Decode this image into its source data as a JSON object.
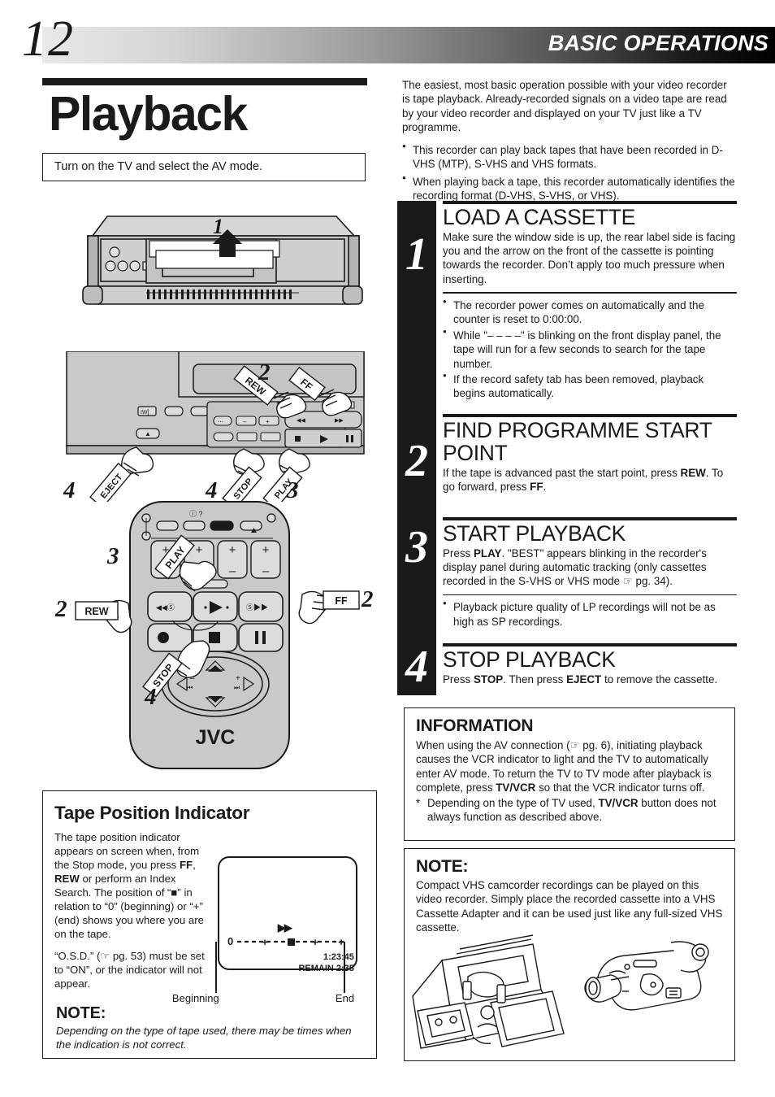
{
  "header": {
    "page_number": "12",
    "section_title": "BASIC OPERATIONS"
  },
  "left": {
    "title": "Playback",
    "intro_box": "Turn on the TV and select the AV mode.",
    "figures": {
      "vcr_top": {
        "name": "vcr-front-loading-cassette",
        "callouts": [
          {
            "label": "1"
          }
        ]
      },
      "vcr_front": {
        "name": "vcr-front-panel-controls",
        "callouts": [
          {
            "num": "2",
            "tag": "REW"
          },
          {
            "num": "2",
            "tag": "FF"
          },
          {
            "num": "4",
            "tag": "EJECT"
          },
          {
            "num": "4",
            "tag": "STOP"
          },
          {
            "num": "3",
            "tag": "PLAY"
          }
        ]
      },
      "remote": {
        "name": "jvc-remote-control",
        "brand": "JVC",
        "callouts": [
          {
            "num": "3",
            "tag": "PLAY"
          },
          {
            "num": "2",
            "tag": "REW"
          },
          {
            "num": "2",
            "tag": "FF"
          },
          {
            "num": "4",
            "tag": "STOP"
          }
        ]
      }
    },
    "tape_indicator": {
      "heading": "Tape Position Indicator",
      "paragraph1_parts": [
        "The tape position indicator appears on screen when, from the Stop mode, you press ",
        "FF",
        ", ",
        "REW",
        " or perform an Index Search. The position of “■” in relation to “0” (beginning) or “+” (end) shows you where you are on the tape."
      ],
      "paragraph2": "“O.S.D.” (☞ pg. 53) must be set to “ON”, or the indicator will not appear.",
      "screen": {
        "direction_indicator": "▶▶",
        "counter": "1:23:45",
        "remain": "REMAIN 2:35",
        "scale_start": "0",
        "scale_marks": [
          "+",
          "+",
          "+"
        ]
      },
      "label_beginning": "Beginning",
      "label_end": "End",
      "note_heading": "NOTE:",
      "note_text": "Depending on the type of tape used, there may be times when the indication is not correct."
    }
  },
  "right": {
    "intro_paragraph": "The easiest, most basic operation possible with your video recorder is tape playback. Already-recorded signals on a video tape are read by your video recorder and displayed on your TV just like a TV programme.",
    "intro_bullets": [
      "This recorder can play back tapes that have been recorded in D-VHS (MTP), S-VHS and VHS formats.",
      "When playing back a tape, this recorder automatically identifies the recording format (D-VHS, S-VHS, or VHS)."
    ],
    "steps": [
      {
        "number": "1",
        "heading": "LOAD A CASSETTE",
        "body": "Make sure the window side is up, the rear label side is facing you and the arrow on the front of the cassette is pointing towards the recorder. Don’t apply too much pressure when inserting.",
        "sub_bullets": [
          "The recorder power comes on automatically and the counter is reset to 0:00:00.",
          "While \"– – – –\" is blinking on the front display panel, the tape will run for a few seconds to search for the tape number.",
          "If the record safety tab has been removed, playback begins automatically."
        ]
      },
      {
        "number": "2",
        "heading": "FIND PROGRAMME START POINT",
        "body_parts": [
          "If the tape is advanced past the start point, press ",
          "REW",
          ". To go forward, press ",
          "FF",
          "."
        ],
        "sub_bullets": []
      },
      {
        "number": "3",
        "heading": "START PLAYBACK",
        "body_parts": [
          "Press ",
          "PLAY",
          ". \"BEST\" appears blinking in the recorder's display panel during automatic tracking (only cassettes recorded in the S-VHS or VHS mode ☞ pg. 34)."
        ],
        "sub_bullets": [
          "Playback picture quality of LP recordings will not be as high as SP recordings."
        ]
      },
      {
        "number": "4",
        "heading": "STOP PLAYBACK",
        "body_parts": [
          "Press ",
          "STOP",
          ". Then press ",
          "EJECT",
          " to remove the cassette."
        ],
        "sub_bullets": []
      }
    ],
    "information": {
      "heading": "INFORMATION",
      "body_parts": [
        "When using the AV connection (☞ pg. 6), initiating playback causes the VCR indicator to light and the TV to automatically enter AV mode.  To return the TV to TV mode after playback is complete, press ",
        "TV/VCR",
        " so that the VCR indicator turns off."
      ],
      "footnote_marker": "*",
      "footnote_parts": [
        "Depending on the type of TV used, ",
        "TV/VCR",
        " button does not always function as described above."
      ]
    },
    "note": {
      "heading": "NOTE:",
      "body": "Compact VHS camcorder recordings can be played on this video recorder. Simply place the recorded cassette into a VHS Cassette Adapter and it can be used just like any full-sized VHS cassette.",
      "figure_name": "vhs-cassette-adapter-and-camcorder"
    }
  },
  "colors": {
    "ink": "#1a1a1a",
    "paper": "#ffffff",
    "band_light": "#e9e9e9",
    "band_dark": "#000000",
    "device_fill": "#c9c9c9"
  }
}
